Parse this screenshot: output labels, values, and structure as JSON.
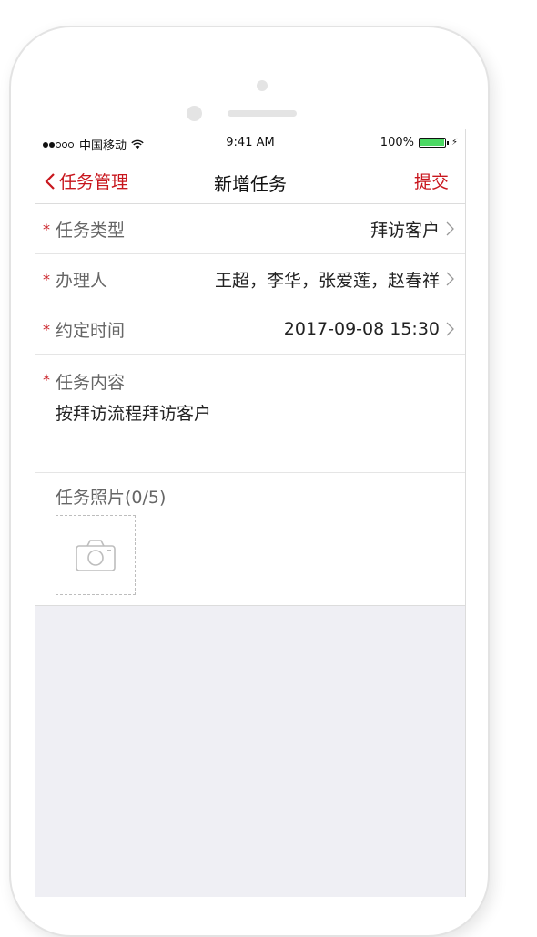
{
  "statusbar": {
    "carrier": "中国移动",
    "time": "9:41 AM",
    "battery": "100%",
    "signal_bars_filled": 2,
    "signal_bars_total": 5
  },
  "navbar": {
    "back_label": "任务管理",
    "title": "新增任务",
    "submit_label": "提交"
  },
  "form": {
    "task_type": {
      "required": "*",
      "label": "任务类型",
      "value": "拜访客户"
    },
    "handler": {
      "required": "*",
      "label": "办理人",
      "value": "王超，李华，张爱莲，赵春祥"
    },
    "appointment_time": {
      "required": "*",
      "label": "约定时间",
      "value": "2017-09-08 15:30"
    },
    "task_content": {
      "required": "*",
      "label": "任务内容",
      "value": "按拜访流程拜访客户"
    },
    "photos": {
      "label": "任务照片(0/5)"
    }
  },
  "colors": {
    "accent": "#c8161d",
    "background": "#efeff4",
    "battery": "#4cd964"
  },
  "icons": [
    "wifi-icon",
    "battery-icon",
    "charging-bolt-icon",
    "back-chevron-icon",
    "chevron-right-icon",
    "camera-icon"
  ]
}
